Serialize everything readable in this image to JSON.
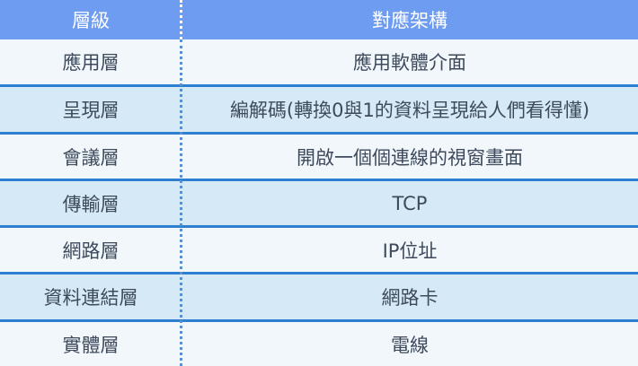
{
  "header": {
    "col1": "層級",
    "col2": "對應架構"
  },
  "rows": [
    {
      "layer": "應用層",
      "arch": "應用軟體介面"
    },
    {
      "layer": "呈現層",
      "arch": "編解碼(轉換0與1的資料呈現給人們看得懂)"
    },
    {
      "layer": "會議層",
      "arch": "開啟一個個連線的視窗畫面"
    },
    {
      "layer": "傳輸層",
      "arch": "TCP"
    },
    {
      "layer": "網路層",
      "arch": "IP位址"
    },
    {
      "layer": "資料連結層",
      "arch": "網路卡"
    },
    {
      "layer": "實體層",
      "arch": "電線"
    }
  ],
  "colors": {
    "header_bg": "#6e9cf0",
    "row_light": "#f2f7fc",
    "row_tint": "#d6e9f6",
    "separator": "#2f7fd0",
    "text": "#3d4a5c"
  }
}
